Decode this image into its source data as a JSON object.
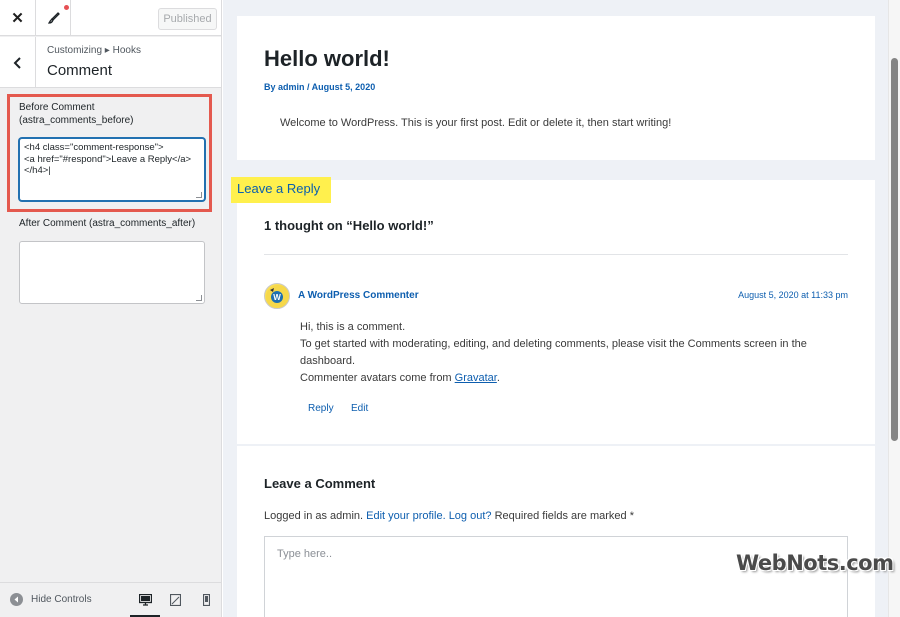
{
  "customizer": {
    "published_label": "Published",
    "breadcrumb": "Customizing ▸ Hooks",
    "section_title": "Comment",
    "before_label": "Before Comment\n(astra_comments_before)",
    "before_value": "<h4 class=\"comment-response\">\n<a href=\"#respond\">Leave a Reply</a>\n</h4>|",
    "after_label": "After Comment (astra_comments_after)",
    "after_value": "",
    "hide_controls_label": "Hide Controls",
    "devices": [
      "desktop-icon",
      "tablet-icon",
      "mobile-icon"
    ],
    "highlight_color": "#e4594e"
  },
  "preview": {
    "post_title": "Hello world!",
    "post_meta": "By admin / August 5, 2020",
    "post_content": "Welcome to WordPress. This is your first post. Edit or delete it, then start writing!",
    "leave_reply": "Leave a Reply",
    "leave_reply_highlight": "#fff04d",
    "comments_title": "1 thought on “Hello world!”",
    "comment": {
      "author": "A WordPress Commenter",
      "date": "August 5, 2020 at 11:33 pm",
      "line1": "Hi, this is a comment.",
      "line2": "To get started with moderating, editing, and deleting comments, please visit the Comments screen in the",
      "line3": "dashboard.",
      "line4_prefix": "Commenter avatars come from ",
      "line4_link": "Gravatar",
      "line4_suffix": ".",
      "reply_label": "Reply",
      "edit_label": "Edit"
    },
    "leave_comment_title": "Leave a Comment",
    "logged_in_prefix": "Logged in as admin. ",
    "edit_profile": "Edit your profile.",
    "logout": "Log out?",
    "required_note": " Required fields are marked *",
    "comment_placeholder": "Type here.."
  },
  "watermark": "WebNots.com"
}
